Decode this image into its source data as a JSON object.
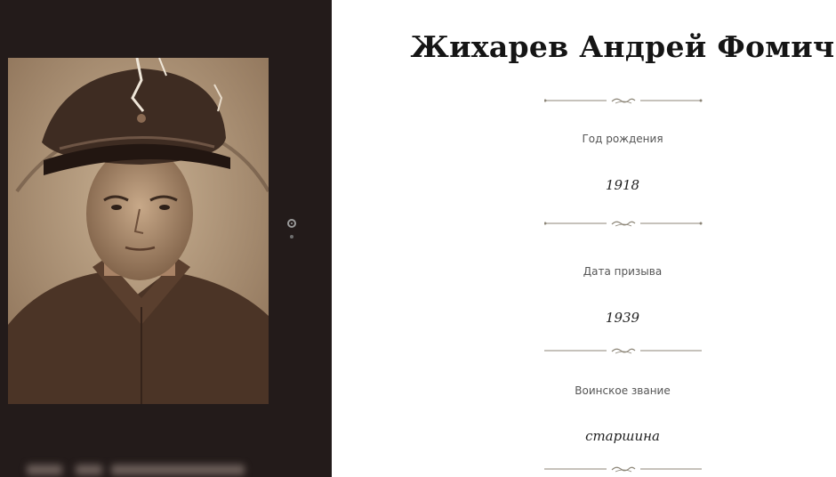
{
  "soldier": {
    "name": "Жихарев Андрей Фомич"
  },
  "fields": [
    {
      "label": "Год рождения",
      "value": "1918"
    },
    {
      "label": "Дата призыва",
      "value": "1939"
    },
    {
      "label": "Воинское звание",
      "value": "старшина"
    }
  ],
  "gallery": {
    "slide_count": 2,
    "active_slide": 1
  },
  "colors": {
    "left_panel_bg": "#231b1a",
    "ornament": "#8c8577",
    "photo_sepia": "#b89d7c"
  }
}
